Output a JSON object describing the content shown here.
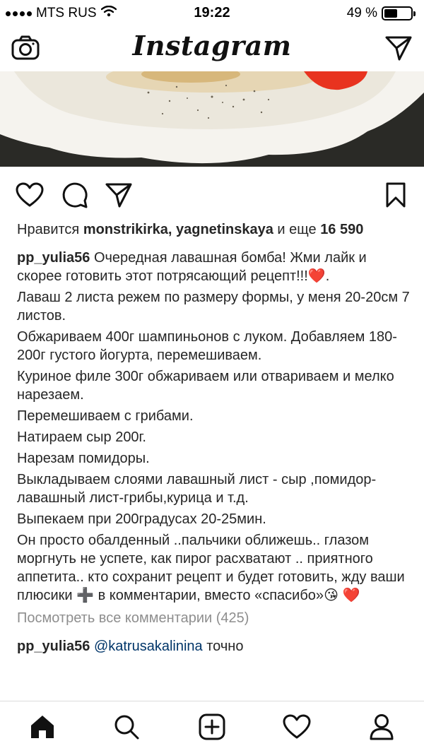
{
  "status_bar": {
    "carrier": "MTS RUS",
    "time": "19:22",
    "battery": "49 %",
    "battery_level": 0.49,
    "icons": [
      "signal-icon",
      "wifi-icon",
      "battery-icon"
    ]
  },
  "header": {
    "logo": "Instagram",
    "left_icon": "camera-icon",
    "right_icon": "direct-message-icon"
  },
  "post": {
    "image_description_icon": "plate-with-food",
    "actions": [
      "heart-icon",
      "comment-icon",
      "share-icon",
      "bookmark-icon"
    ],
    "likes": {
      "prefix": "Нравится",
      "users": "monstrikirka, yagnetinskaya",
      "conjunction": "и еще",
      "count": "16 590"
    },
    "caption": {
      "username": "pp_yulia56",
      "lines": [
        "Очередная лавашная бомба! Жми лайк и скорее готовить этот потрясающий рецепт!!!",
        "Лаваш 2 листа режем по размеру формы, у меня 20-20см 7 листов.",
        "Обжариваем 400г шампиньонов с луком. Добавляем 180-200г густого йогурта, перемешиваем.",
        "Куриное филе 300г обжариваем или отвариваем и мелко нарезаем.",
        "Перемешиваем с грибами.",
        "Натираем сыр 200г.",
        "Нарезам помидоры.",
        "Выкладываем слоями лавашный лист - сыр ,помидор-лавашный лист-грибы,курица и т.д.",
        "Выпекаем при 200градусах 20-25мин.",
        "Он просто обалденный ..пальчики оближешь.. глазом моргнуть не успете, как пирог расхватают .. приятного аппетита.. кто сохранит рецепт и будет готовить, жду ваши плюсики",
        "в комментарии, вместо «спасибо»"
      ],
      "emoji_heart": "❤️",
      "emoji_plus": "➕",
      "emoji_kiss": "😘"
    },
    "view_comments": "Посмотреть все комментарии (425)",
    "comment": {
      "username": "pp_yulia56",
      "mention": "@katrusakalinina",
      "text": "точно"
    }
  },
  "bottom_nav": {
    "items": [
      "home-icon",
      "search-icon",
      "add-post-icon",
      "activity-heart-icon",
      "profile-icon"
    ]
  },
  "colors": {
    "text": "#262626",
    "muted": "#8e8e8e",
    "link": "#003569",
    "heart": "#e0245e",
    "tomato": "#e8331f"
  }
}
